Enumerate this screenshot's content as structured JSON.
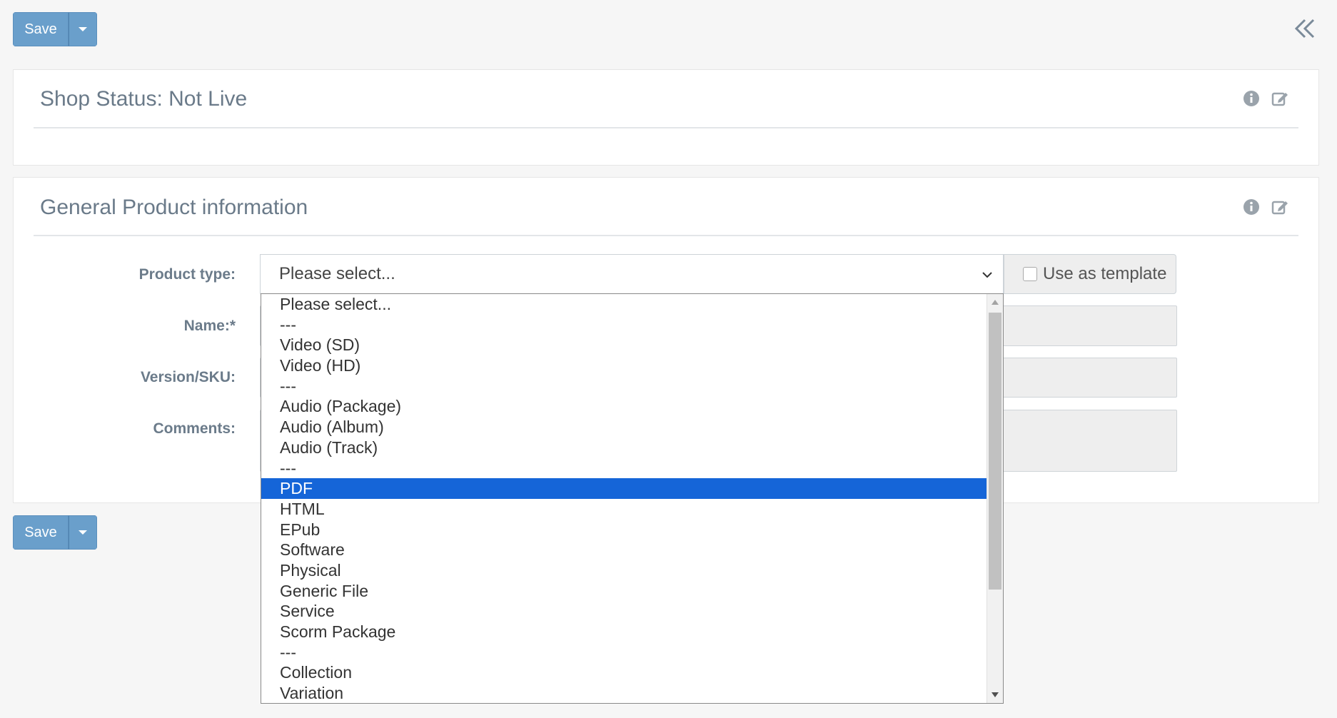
{
  "toolbar": {
    "save_label": "Save"
  },
  "shop_status": {
    "title": "Shop Status: Not Live"
  },
  "general_info": {
    "title": "General Product information",
    "labels": {
      "product_type": "Product type:",
      "name": "Name:*",
      "version": "Version/SKU:",
      "comments": "Comments:"
    },
    "product_type_value": "Please select...",
    "use_as_template_label": "Use as template"
  },
  "product_type_options": [
    "Please select...",
    "---",
    "Video (SD)",
    "Video (HD)",
    "---",
    "Audio (Package)",
    "Audio (Album)",
    "Audio (Track)",
    "---",
    "PDF",
    "HTML",
    "EPub",
    "Software",
    "Physical",
    "Generic File",
    "Service",
    "Scorm Package",
    "---",
    "Collection",
    "Variation"
  ],
  "highlighted_option": "PDF",
  "colors": {
    "button": "#6a9fcb",
    "highlight": "#1565d8",
    "title": "#6a7a89"
  }
}
